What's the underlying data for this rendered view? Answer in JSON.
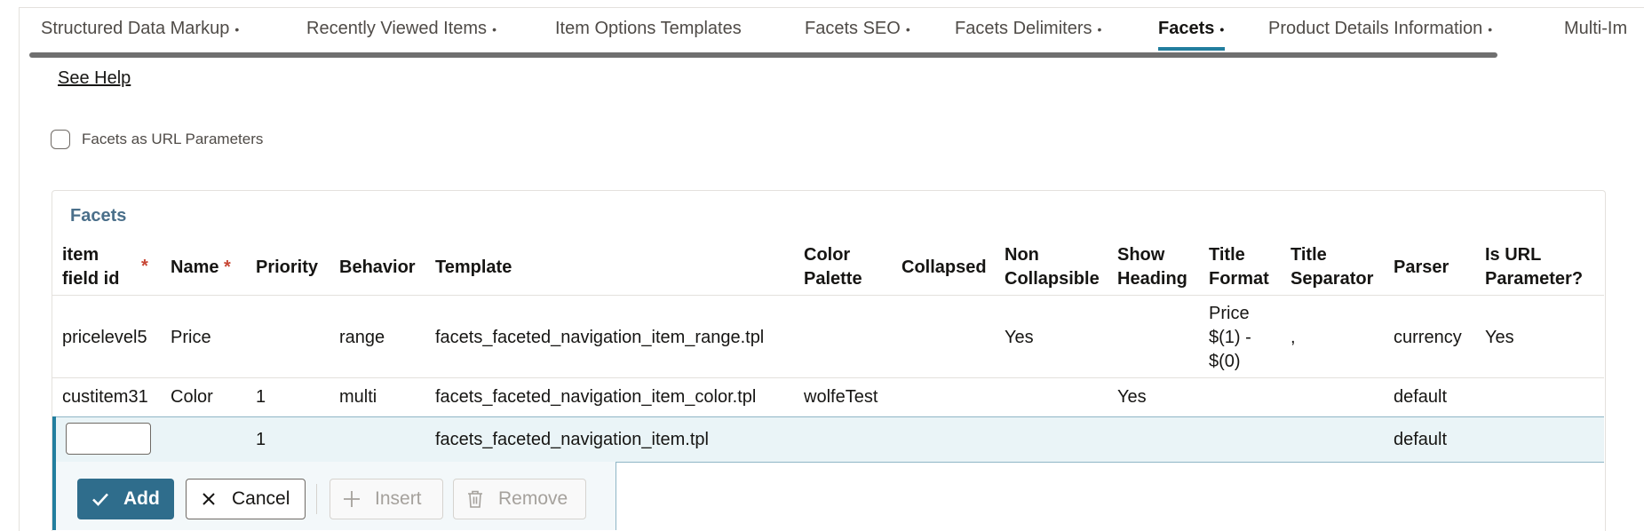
{
  "tabs": [
    {
      "label": "Structured Data Markup",
      "dot": "•"
    },
    {
      "label": "Recently Viewed Items",
      "dot": "•"
    },
    {
      "label": "Item Options Templates",
      "dot": ""
    },
    {
      "label": "Facets SEO",
      "dot": "•"
    },
    {
      "label": "Facets Delimiters",
      "dot": "•"
    },
    {
      "label": "Facets",
      "dot": "•",
      "active": true
    },
    {
      "label": "Product Details Information",
      "dot": "•"
    },
    {
      "label": "Multi-Im",
      "dot": ""
    }
  ],
  "help_link": "See Help",
  "facets_url_param": {
    "label": "Facets as URL Parameters",
    "checked": false
  },
  "panel": {
    "title": "Facets",
    "columns": {
      "item_field_id": {
        "l1": "item",
        "l2": "field id",
        "required": "*"
      },
      "name": {
        "l1": "Name",
        "required": "*"
      },
      "priority": {
        "l1": "Priority"
      },
      "behavior": {
        "l1": "Behavior"
      },
      "template": {
        "l1": "Template"
      },
      "color_palette": {
        "l1": "Color",
        "l2": "Palette"
      },
      "collapsed": {
        "l1": "Collapsed"
      },
      "non_collapsible": {
        "l1": "Non",
        "l2": "Collapsible"
      },
      "show_heading": {
        "l1": "Show",
        "l2": "Heading"
      },
      "title_format": {
        "l1": "Title",
        "l2": "Format"
      },
      "title_separator": {
        "l1": "Title",
        "l2": "Separator"
      },
      "parser": {
        "l1": "Parser"
      },
      "is_url_parameter": {
        "l1": "Is URL",
        "l2": "Parameter?"
      }
    },
    "rows": [
      {
        "item_field_id": "pricelevel5",
        "name": "Price",
        "priority": "",
        "behavior": "range",
        "template": "facets_faceted_navigation_item_range.tpl",
        "color_palette": "",
        "collapsed": "",
        "non_collapsible": "Yes",
        "show_heading": "",
        "title_format": {
          "l1": "Price",
          "l2": "$(1) -",
          "l3": "$(0)"
        },
        "title_separator": ",",
        "parser": "currency",
        "is_url_parameter": "Yes"
      },
      {
        "item_field_id": "custitem31",
        "name": "Color",
        "priority": "1",
        "behavior": "multi",
        "template": "facets_faceted_navigation_item_color.tpl",
        "color_palette": "wolfeTest",
        "collapsed": "",
        "non_collapsible": "",
        "show_heading": "Yes",
        "title_format": "",
        "title_separator": "",
        "parser": "default",
        "is_url_parameter": ""
      }
    ],
    "edit_row": {
      "item_field_id": "",
      "priority": "1",
      "template": "facets_faceted_navigation_item.tpl",
      "parser": "default"
    }
  },
  "actions": {
    "add": "Add",
    "cancel": "Cancel",
    "insert": "Insert",
    "remove": "Remove"
  }
}
